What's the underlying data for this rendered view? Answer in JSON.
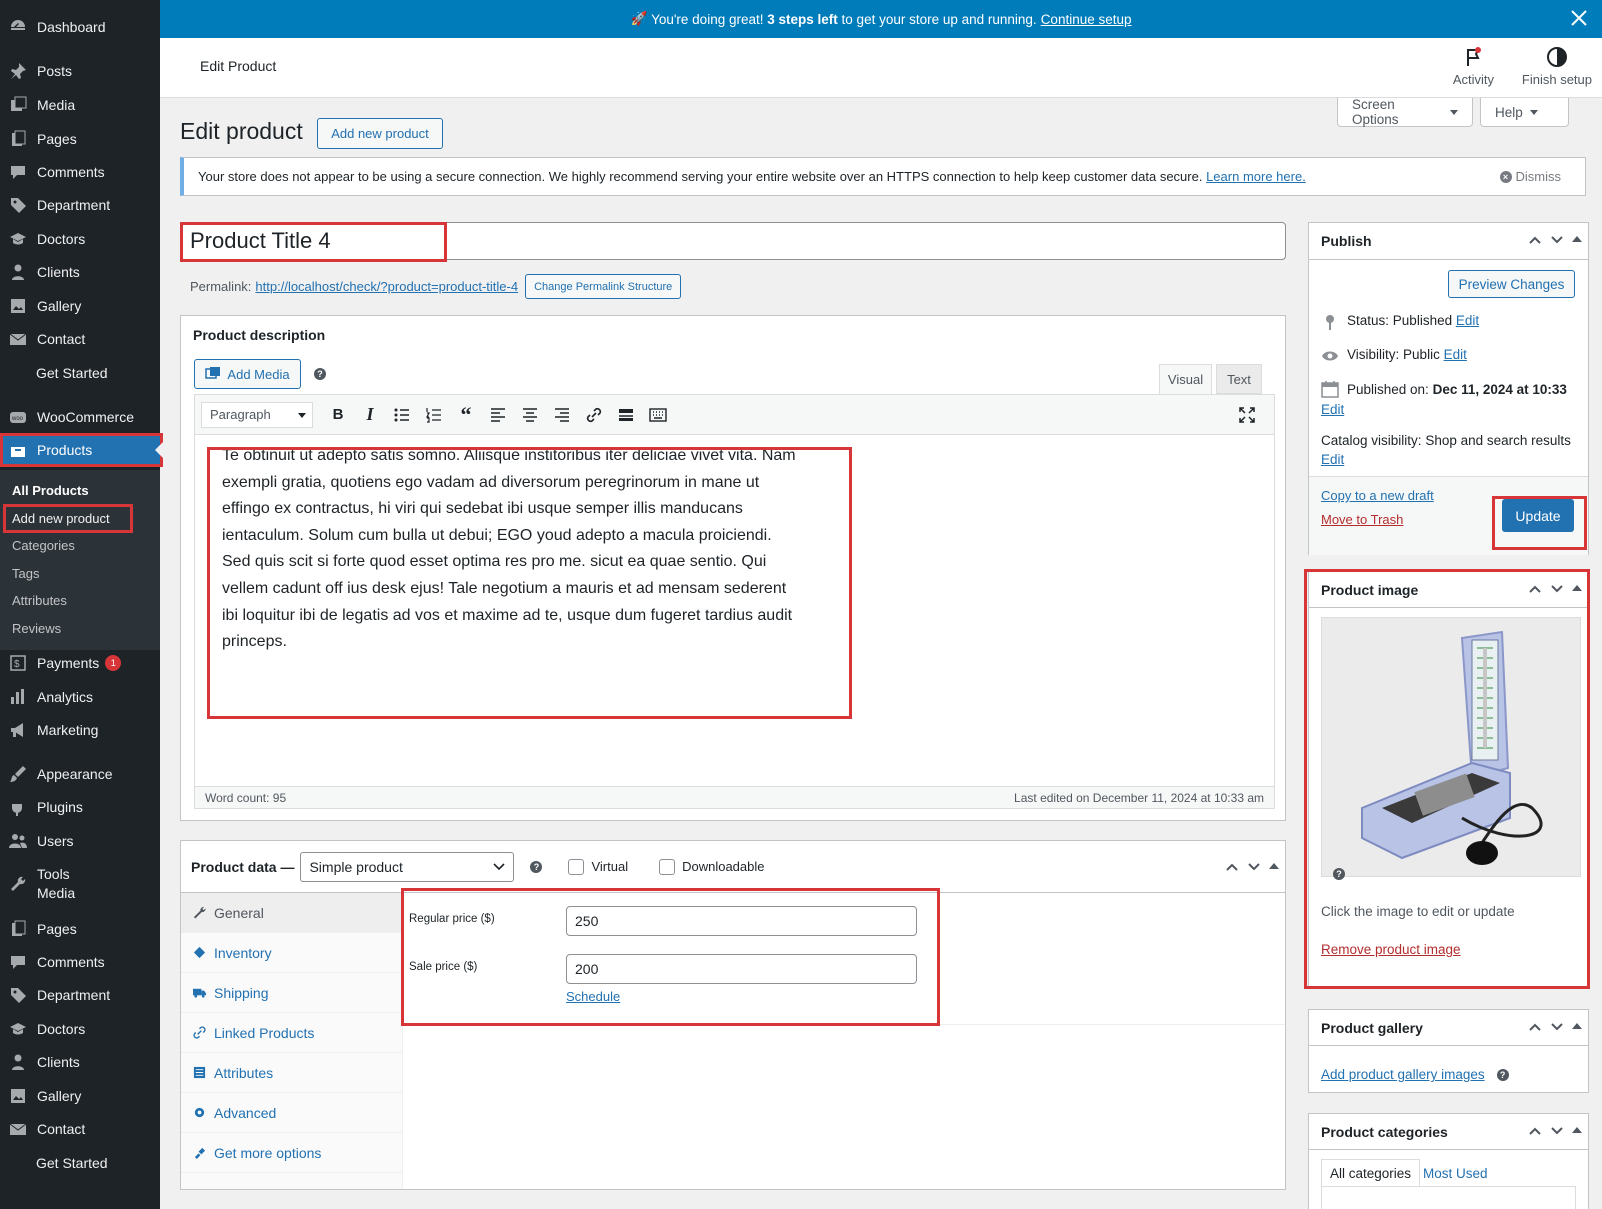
{
  "sidebar": {
    "top": [
      {
        "label": "Dashboard",
        "icon": "dashboard-icon"
      },
      {
        "label": "Posts",
        "icon": "pin-icon"
      },
      {
        "label": "Media",
        "icon": "media-icon"
      },
      {
        "label": "Pages",
        "icon": "pages-icon"
      },
      {
        "label": "Comments",
        "icon": "comment-icon"
      },
      {
        "label": "Department",
        "icon": "tag-icon"
      },
      {
        "label": "Doctors",
        "icon": "graduation-cap-icon"
      },
      {
        "label": "Clients",
        "icon": "person-icon"
      },
      {
        "label": "Gallery",
        "icon": "gallery-icon"
      },
      {
        "label": "Contact",
        "icon": "mail-icon"
      },
      {
        "label": "Get Started",
        "icon": ""
      },
      {
        "label": "WooCommerce",
        "icon": "woo-icon"
      },
      {
        "label": "Products",
        "icon": "products-icon"
      }
    ],
    "submenu": [
      "All Products",
      "Add new product",
      "Categories",
      "Tags",
      "Attributes",
      "Reviews"
    ],
    "bottom": [
      {
        "label": "Payments",
        "icon": "payments-icon",
        "badge": "1"
      },
      {
        "label": "Analytics",
        "icon": "analytics-icon"
      },
      {
        "label": "Marketing",
        "icon": "megaphone-icon"
      },
      {
        "label": "Appearance",
        "icon": "brush-icon"
      },
      {
        "label": "Plugins",
        "icon": "plug-icon"
      },
      {
        "label": "Users",
        "icon": "users-icon"
      },
      {
        "label": "Tools",
        "icon": "wrench-icon",
        "sub": "Media"
      },
      {
        "label": "Pages",
        "icon": "pages-icon"
      },
      {
        "label": "Comments",
        "icon": "comment-icon"
      },
      {
        "label": "Department",
        "icon": "tag-icon"
      },
      {
        "label": "Doctors",
        "icon": "graduation-cap-icon"
      },
      {
        "label": "Clients",
        "icon": "person-icon"
      },
      {
        "label": "Gallery",
        "icon": "gallery-icon"
      },
      {
        "label": "Contact",
        "icon": "mail-icon"
      },
      {
        "label": "Get Started",
        "icon": ""
      }
    ]
  },
  "banner": {
    "emoji": "🚀",
    "pre": "You're doing great!",
    "bold": "3 steps left",
    "post": "to get your store up and running.",
    "link": "Continue setup"
  },
  "header": {
    "title": "Edit Product",
    "activity": "Activity",
    "finish": "Finish setup"
  },
  "tabs": {
    "screen_options": "Screen Options",
    "help": "Help"
  },
  "page": {
    "title": "Edit product",
    "add_new": "Add new product"
  },
  "notice": {
    "text": "Your store does not appear to be using a secure connection. We highly recommend serving your entire website over an HTTPS connection to help keep customer data secure.",
    "link": "Learn more here.",
    "dismiss": "Dismiss"
  },
  "product": {
    "title": "Product Title 4",
    "permalink_label": "Permalink:",
    "permalink": "http://localhost/check/?product=product-title-4",
    "change_permalink": "Change Permalink Structure"
  },
  "description": {
    "heading": "Product description",
    "add_media": "Add Media",
    "tab_visual": "Visual",
    "tab_text": "Text",
    "format": "Paragraph",
    "content": "Te obtinuit ut adepto satis somno. Aliisque institoribus iter deliciae vivet vita. Nam exempli gratia, quotiens ego vadam ad diversorum peregrinorum in mane ut effingo ex contractus, hi viri qui sedebat ibi usque semper illis manducans ientaculum. Solum cum bulla ut debui; EGO youd adepto a macula proiciendi. Sed quis scit si forte quod esset optima res pro me. sicut ea quae sentio. Qui vellem cadunt off ius desk ejus! Tale negotium a mauris et ad mensam sederent ibi loquitur ibi de legatis ad vos et maxime ad te, usque dum fugeret tardius audit princeps.",
    "word_count": "Word count: 95",
    "last_edited": "Last edited on December 11, 2024 at 10:33 am"
  },
  "product_data": {
    "label": "Product data —",
    "type": "Simple product",
    "virtual": "Virtual",
    "downloadable": "Downloadable",
    "tabs": [
      {
        "label": "General",
        "icon": "wrench-icon"
      },
      {
        "label": "Inventory",
        "icon": "inventory-icon"
      },
      {
        "label": "Shipping",
        "icon": "truck-icon"
      },
      {
        "label": "Linked Products",
        "icon": "link-icon"
      },
      {
        "label": "Attributes",
        "icon": "list-icon"
      },
      {
        "label": "Advanced",
        "icon": "gear-icon"
      },
      {
        "label": "Get more options",
        "icon": "plugin-icon"
      }
    ],
    "regular_label": "Regular price ($)",
    "regular_value": "250",
    "sale_label": "Sale price ($)",
    "sale_value": "200",
    "schedule": "Schedule"
  },
  "publish": {
    "heading": "Publish",
    "preview": "Preview Changes",
    "status_label": "Status:",
    "status": "Published",
    "visibility_label": "Visibility:",
    "visibility": "Public",
    "published_label": "Published on:",
    "published": "Dec 11, 2024 at 10:33",
    "catalog_label": "Catalog visibility:",
    "catalog": "Shop and search results",
    "edit": "Edit",
    "copy": "Copy to a new draft",
    "trash": "Move to Trash",
    "update": "Update"
  },
  "product_image": {
    "heading": "Product image",
    "hint": "Click the image to edit or update",
    "remove": "Remove product image"
  },
  "gallery": {
    "heading": "Product gallery",
    "add": "Add product gallery images"
  },
  "categories": {
    "heading": "Product categories",
    "tab_all": "All categories",
    "tab_used": "Most Used"
  },
  "colors": {
    "accent": "#2271b1",
    "sidebar": "#1d2327",
    "banner": "#007cba",
    "highlight": "#d63638"
  }
}
